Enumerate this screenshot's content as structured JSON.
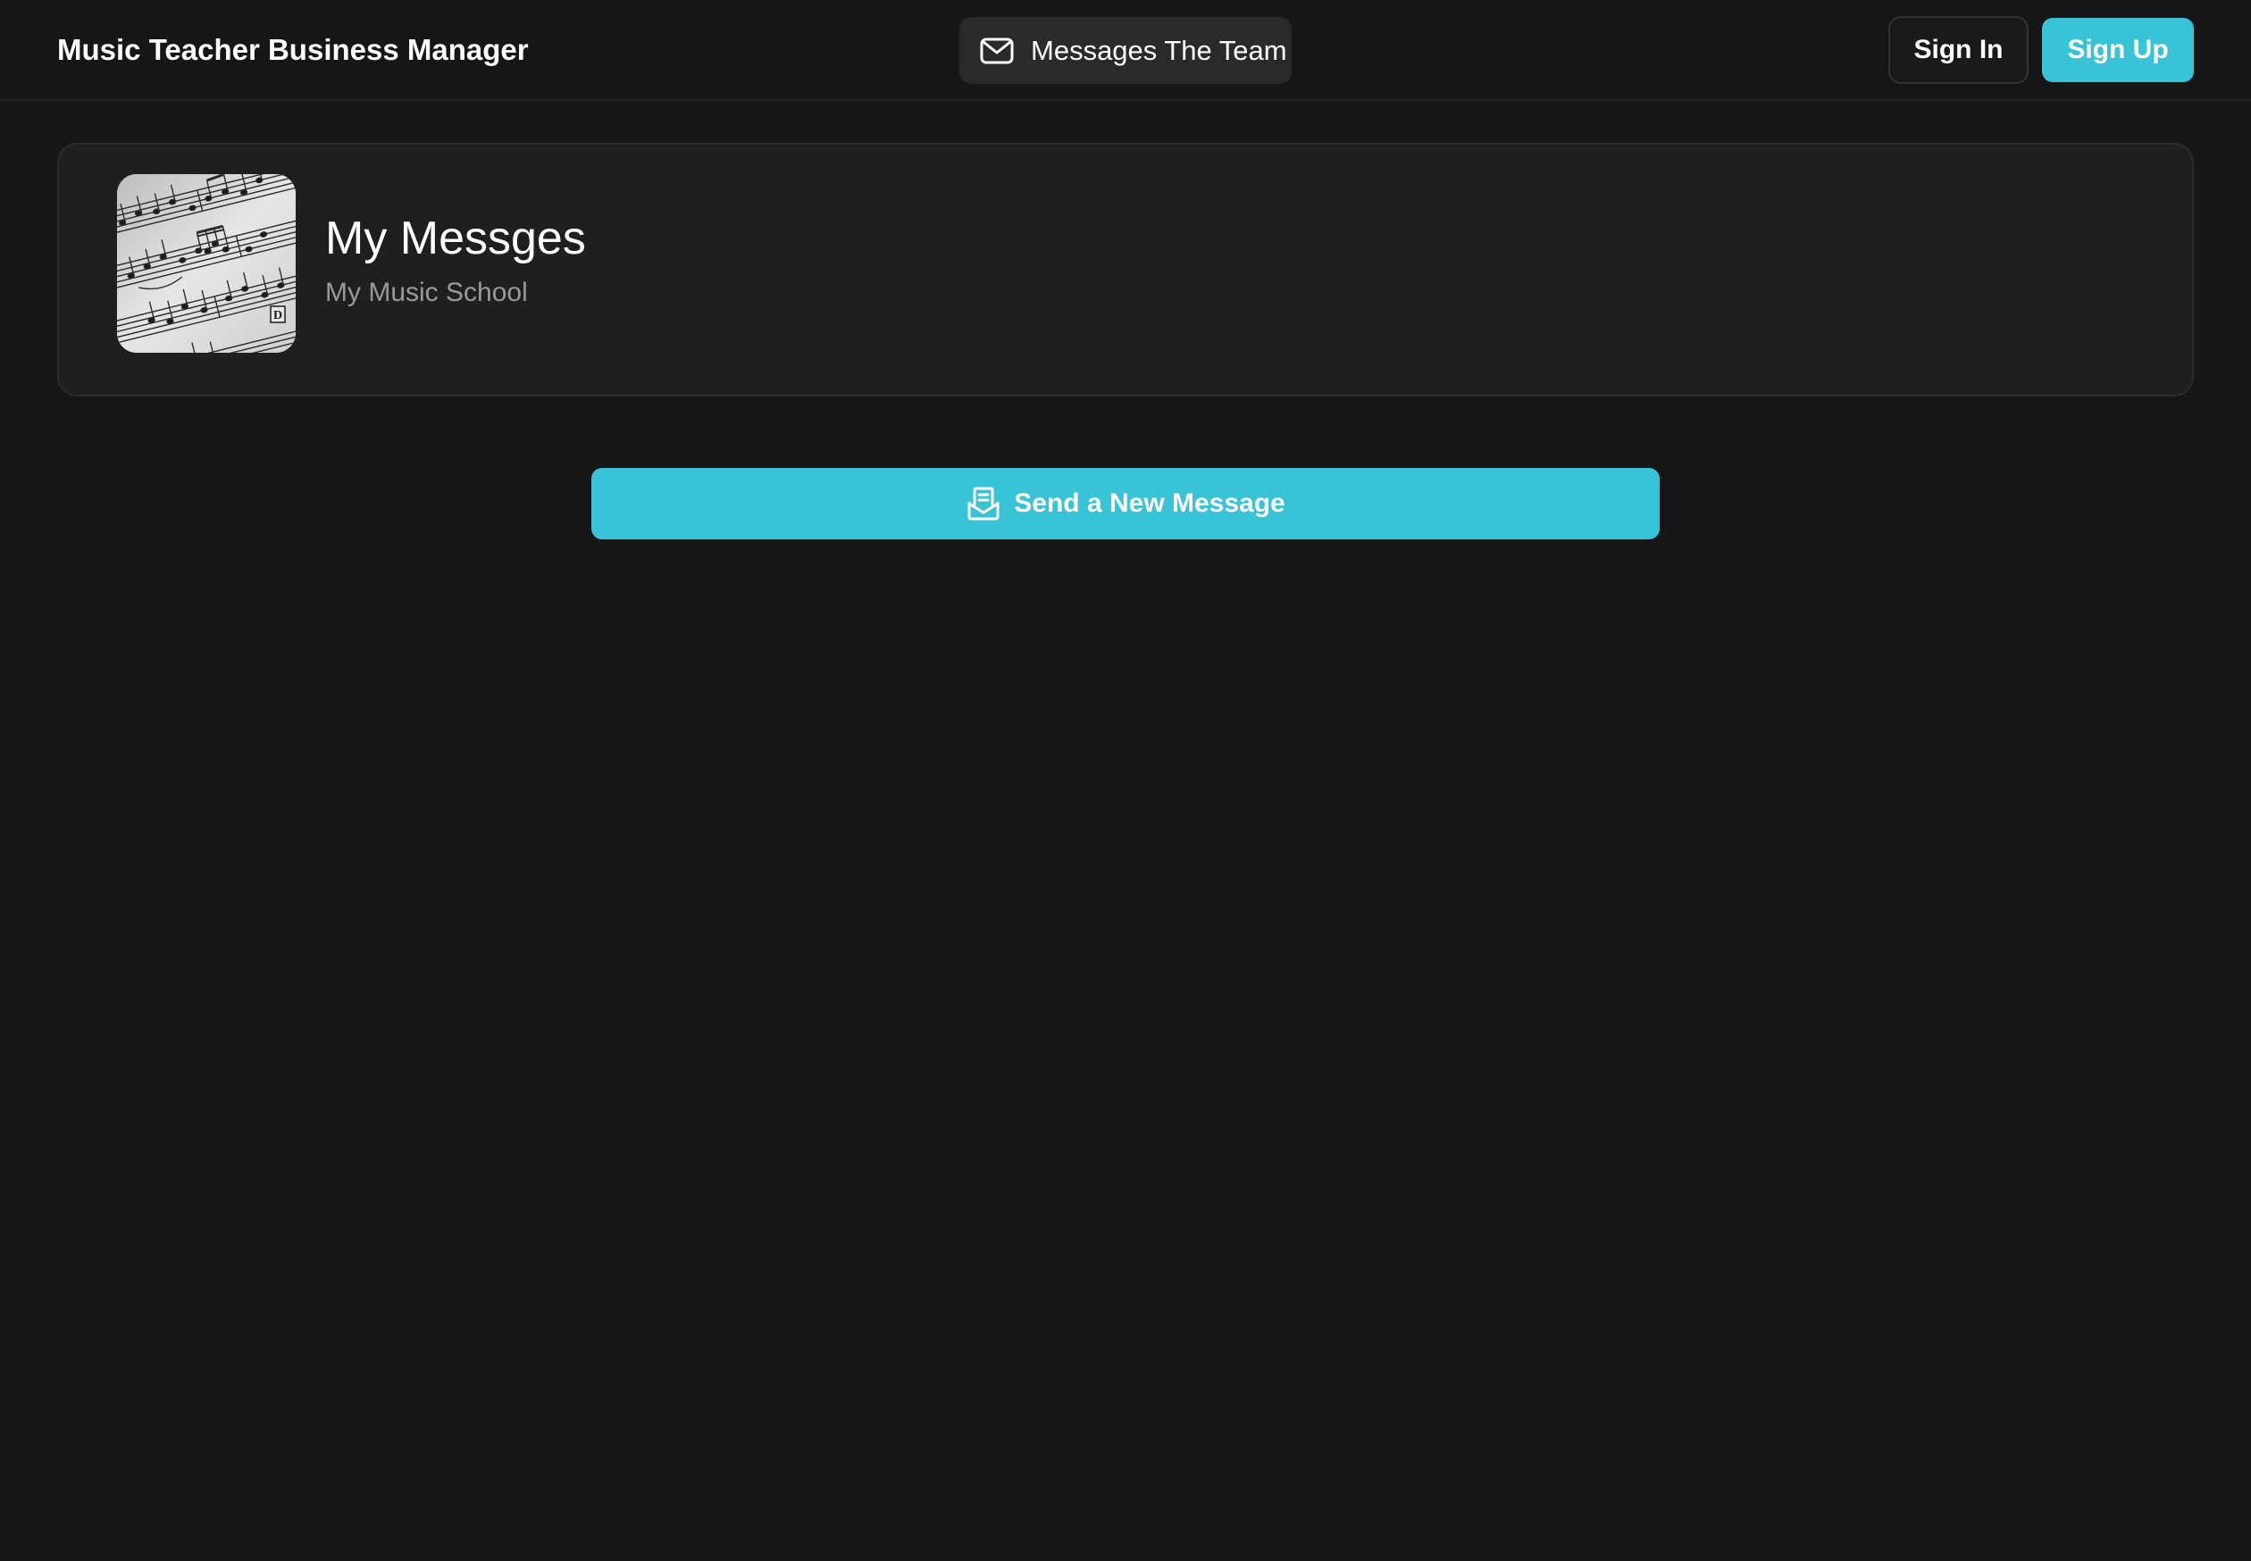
{
  "header": {
    "app_title": "Music Teacher Business Manager",
    "nav_messages_label": "Messages The Team",
    "nav_messages_icon": "envelope-icon",
    "sign_in_label": "Sign In",
    "sign_up_label": "Sign Up"
  },
  "page": {
    "title": "My Messges",
    "subtitle": "My Music School",
    "cover_image": "sheet-music-image"
  },
  "actions": {
    "send_new_message_label": "Send a New Message",
    "send_new_message_icon": "inbox-message-icon"
  },
  "colors": {
    "background": "#161616",
    "card": "#1f1f1f",
    "accent": "#39c3d6",
    "muted_text": "#9a9a9a"
  }
}
